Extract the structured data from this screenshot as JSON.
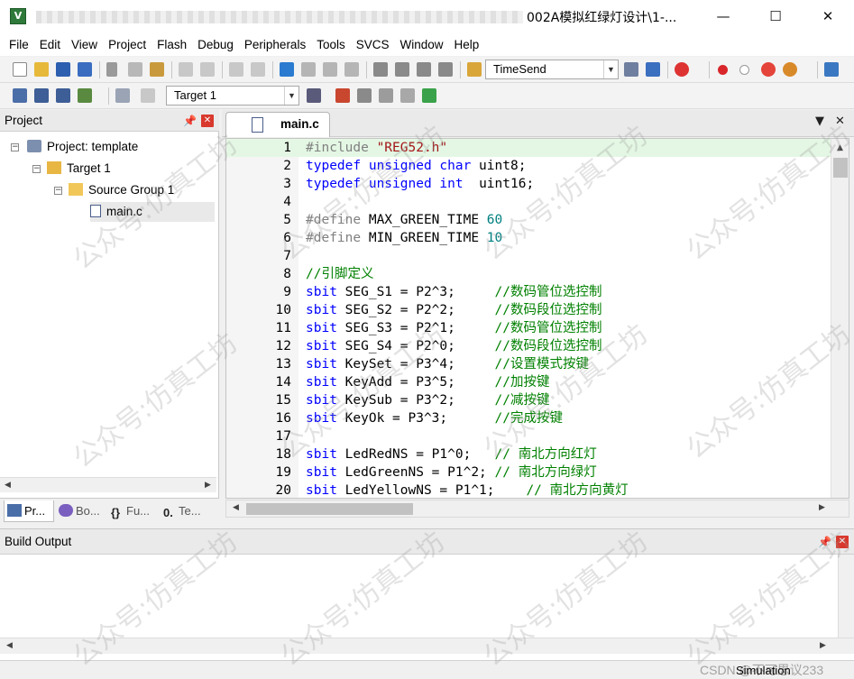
{
  "window": {
    "title": "002A模拟红绿灯设计\\1-...",
    "minimize": "—",
    "maximize": "☐",
    "close": "✕"
  },
  "menu": [
    "File",
    "Edit",
    "View",
    "Project",
    "Flash",
    "Debug",
    "Peripherals",
    "Tools",
    "SVCS",
    "Window",
    "Help"
  ],
  "toolbar": {
    "find_combo": "TimeSend",
    "target_combo": "Target 1"
  },
  "project_panel": {
    "title": "Project",
    "pin": "📌",
    "close": "✕",
    "tree": {
      "project": "Project: template",
      "target": "Target 1",
      "group": "Source Group 1",
      "file": "main.c"
    },
    "tabs": [
      "Pr...",
      "Bo...",
      "Fu...",
      "Te..."
    ]
  },
  "editor": {
    "tab_label": "main.c",
    "lines": [
      {
        "n": "1",
        "parts": [
          {
            "c": "pp",
            "t": "#include "
          },
          {
            "c": "st",
            "t": "\"REG52.h\""
          }
        ]
      },
      {
        "n": "2",
        "parts": [
          {
            "c": "k",
            "t": "typedef unsigned char"
          },
          {
            "c": "",
            "t": " uint8;"
          }
        ]
      },
      {
        "n": "3",
        "parts": [
          {
            "c": "k",
            "t": "typedef unsigned int"
          },
          {
            "c": "",
            "t": "  uint16;"
          }
        ]
      },
      {
        "n": "4",
        "parts": []
      },
      {
        "n": "5",
        "parts": [
          {
            "c": "pp",
            "t": "#define"
          },
          {
            "c": "",
            "t": " MAX_GREEN_TIME "
          },
          {
            "c": "nm",
            "t": "60"
          }
        ]
      },
      {
        "n": "6",
        "parts": [
          {
            "c": "pp",
            "t": "#define"
          },
          {
            "c": "",
            "t": " MIN_GREEN_TIME "
          },
          {
            "c": "nm",
            "t": "10"
          }
        ]
      },
      {
        "n": "7",
        "parts": []
      },
      {
        "n": "8",
        "parts": [
          {
            "c": "cm",
            "t": "//引脚定义"
          }
        ]
      },
      {
        "n": "9",
        "parts": [
          {
            "c": "k",
            "t": "sbit"
          },
          {
            "c": "",
            "t": " SEG_S1 = P2^3;     "
          },
          {
            "c": "cm",
            "t": "//数码管位选控制"
          }
        ]
      },
      {
        "n": "10",
        "parts": [
          {
            "c": "k",
            "t": "sbit"
          },
          {
            "c": "",
            "t": " SEG_S2 = P2^2;     "
          },
          {
            "c": "cm",
            "t": "//数码段位选控制"
          }
        ]
      },
      {
        "n": "11",
        "parts": [
          {
            "c": "k",
            "t": "sbit"
          },
          {
            "c": "",
            "t": " SEG_S3 = P2^1;     "
          },
          {
            "c": "cm",
            "t": "//数码管位选控制"
          }
        ]
      },
      {
        "n": "12",
        "parts": [
          {
            "c": "k",
            "t": "sbit"
          },
          {
            "c": "",
            "t": " SEG_S4 = P2^0;     "
          },
          {
            "c": "cm",
            "t": "//数码段位选控制"
          }
        ]
      },
      {
        "n": "13",
        "parts": [
          {
            "c": "k",
            "t": "sbit"
          },
          {
            "c": "",
            "t": " KeySet = P3^4;     "
          },
          {
            "c": "cm",
            "t": "//设置模式按键"
          }
        ]
      },
      {
        "n": "14",
        "parts": [
          {
            "c": "k",
            "t": "sbit"
          },
          {
            "c": "",
            "t": " KeyAdd = P3^5;     "
          },
          {
            "c": "cm",
            "t": "//加按键"
          }
        ]
      },
      {
        "n": "15",
        "parts": [
          {
            "c": "k",
            "t": "sbit"
          },
          {
            "c": "",
            "t": " KeySub = P3^2;     "
          },
          {
            "c": "cm",
            "t": "//减按键"
          }
        ]
      },
      {
        "n": "16",
        "parts": [
          {
            "c": "k",
            "t": "sbit"
          },
          {
            "c": "",
            "t": " KeyOk = P3^3;      "
          },
          {
            "c": "cm",
            "t": "//完成按键"
          }
        ]
      },
      {
        "n": "17",
        "parts": []
      },
      {
        "n": "18",
        "parts": [
          {
            "c": "k",
            "t": "sbit"
          },
          {
            "c": "",
            "t": " LedRedNS = P1^0;   "
          },
          {
            "c": "cm",
            "t": "// 南北方向红灯"
          }
        ]
      },
      {
        "n": "19",
        "parts": [
          {
            "c": "k",
            "t": "sbit"
          },
          {
            "c": "",
            "t": " LedGreenNS = P1^2; "
          },
          {
            "c": "cm",
            "t": "// 南北方向绿灯"
          }
        ]
      },
      {
        "n": "20",
        "parts": [
          {
            "c": "k",
            "t": "sbit"
          },
          {
            "c": "",
            "t": " LedYellowNS = P1^1;    "
          },
          {
            "c": "cm",
            "t": "// 南北方向黄灯"
          }
        ]
      }
    ]
  },
  "build_output": {
    "title": "Build Output"
  },
  "status": {
    "mode": "Simulation",
    "credit": "CSDN @不可思议233"
  },
  "watermark": "公众号:仿真工坊"
}
